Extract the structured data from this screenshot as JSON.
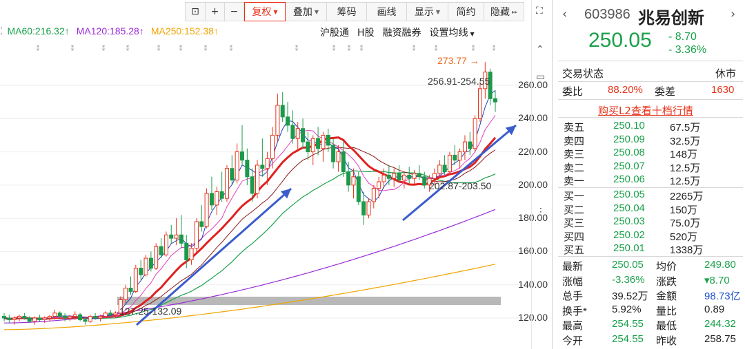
{
  "toolbar": {
    "buttons": [
      {
        "label": "",
        "icon": "lock-icon"
      },
      {
        "label": "+",
        "icon": "zoom-in-icon"
      },
      {
        "label": "−",
        "icon": "zoom-out-icon"
      },
      {
        "label": "复权",
        "dropdown": true,
        "active": true
      },
      {
        "label": "叠加",
        "dropdown": true
      },
      {
        "label": "筹码"
      },
      {
        "label": "画线"
      },
      {
        "label": "显示",
        "dropdown": true
      },
      {
        "label": "简约"
      },
      {
        "label": "隐藏",
        "more": "▸▸"
      }
    ]
  },
  "ma_legend": [
    {
      "label": "MA60:216.32",
      "arrow": "↑",
      "color": "#1aa04a"
    },
    {
      "label": "MA120:185.28",
      "arrow": "↑",
      "color": "#9a2bd8"
    },
    {
      "label": "MA250:152.38",
      "arrow": "↑",
      "color": "#f0a500"
    }
  ],
  "sub_links": [
    "沪股通",
    "H股",
    "融资融券",
    "设置均线"
  ],
  "y_axis": {
    "ticks": [
      "260.00",
      "240.00",
      "220.00",
      "200.00",
      "180.00",
      "160.00",
      "140.00",
      "120.00"
    ]
  },
  "annotations": {
    "high_marker": "273.77",
    "high_arrow": "→",
    "range_top": "256.91-254.55",
    "range_mid": "202.87-203.50",
    "range_bottom": "127.25-132.09"
  },
  "chart_data": {
    "type": "candlestick",
    "ylim": [
      110,
      280
    ],
    "y_ticks": [
      260,
      240,
      220,
      200,
      180,
      160,
      140,
      120
    ],
    "series": [
      {
        "name": "MA60",
        "color": "#1aa04a"
      },
      {
        "name": "MA120",
        "color": "#9a2bd8"
      },
      {
        "name": "MA250",
        "color": "#f0a500"
      }
    ],
    "candles": [
      [
        121,
        123,
        118,
        120
      ],
      [
        120,
        122,
        117,
        119
      ],
      [
        119,
        121,
        116,
        120
      ],
      [
        120,
        122,
        118,
        121
      ],
      [
        121,
        123,
        119,
        120
      ],
      [
        120,
        121,
        117,
        118
      ],
      [
        118,
        121,
        116,
        120
      ],
      [
        120,
        122,
        118,
        119
      ],
      [
        119,
        121,
        117,
        120
      ],
      [
        120,
        122,
        118,
        121
      ],
      [
        121,
        125,
        119,
        123
      ],
      [
        123,
        124,
        120,
        121
      ],
      [
        121,
        123,
        118,
        120
      ],
      [
        120,
        122,
        118,
        121
      ],
      [
        121,
        124,
        119,
        122
      ],
      [
        122,
        123,
        118,
        119
      ],
      [
        119,
        121,
        116,
        118
      ],
      [
        118,
        122,
        117,
        121
      ],
      [
        121,
        123,
        119,
        120
      ],
      [
        120,
        122,
        118,
        121
      ],
      [
        121,
        124,
        120,
        123
      ],
      [
        123,
        125,
        121,
        122
      ],
      [
        122,
        124,
        120,
        123
      ],
      [
        123,
        133,
        122,
        131
      ],
      [
        131,
        140,
        129,
        138
      ],
      [
        138,
        145,
        134,
        136
      ],
      [
        136,
        152,
        135,
        150
      ],
      [
        150,
        155,
        143,
        146
      ],
      [
        146,
        158,
        145,
        156
      ],
      [
        156,
        160,
        148,
        150
      ],
      [
        150,
        165,
        149,
        163
      ],
      [
        163,
        168,
        156,
        158
      ],
      [
        158,
        172,
        157,
        170
      ],
      [
        170,
        176,
        165,
        168
      ],
      [
        168,
        180,
        164,
        170
      ],
      [
        170,
        182,
        162,
        165
      ],
      [
        165,
        170,
        150,
        155
      ],
      [
        155,
        165,
        152,
        162
      ],
      [
        162,
        180,
        160,
        178
      ],
      [
        178,
        188,
        172,
        175
      ],
      [
        175,
        198,
        174,
        195
      ],
      [
        195,
        205,
        185,
        188
      ],
      [
        188,
        199,
        182,
        196
      ],
      [
        196,
        208,
        190,
        192
      ],
      [
        192,
        212,
        190,
        210
      ],
      [
        210,
        218,
        200,
        203
      ],
      [
        203,
        225,
        201,
        220
      ],
      [
        220,
        236,
        212,
        215
      ],
      [
        215,
        222,
        200,
        205
      ],
      [
        205,
        210,
        190,
        195
      ],
      [
        195,
        215,
        192,
        212
      ],
      [
        212,
        228,
        205,
        210
      ],
      [
        210,
        220,
        200,
        216
      ],
      [
        216,
        235,
        210,
        230
      ],
      [
        230,
        255,
        226,
        248
      ],
      [
        248,
        256,
        238,
        241
      ],
      [
        241,
        250,
        232,
        236
      ],
      [
        236,
        245,
        225,
        228
      ],
      [
        228,
        238,
        220,
        234
      ],
      [
        234,
        240,
        222,
        226
      ],
      [
        226,
        232,
        215,
        220
      ],
      [
        220,
        230,
        212,
        228
      ],
      [
        228,
        235,
        218,
        222
      ],
      [
        222,
        232,
        214,
        230
      ],
      [
        230,
        234,
        220,
        224
      ],
      [
        224,
        228,
        210,
        214
      ],
      [
        214,
        224,
        208,
        220
      ],
      [
        220,
        226,
        205,
        208
      ],
      [
        208,
        214,
        196,
        200
      ],
      [
        200,
        210,
        192,
        205
      ],
      [
        205,
        208,
        188,
        190
      ],
      [
        190,
        196,
        176,
        182
      ],
      [
        182,
        192,
        180,
        190
      ],
      [
        190,
        200,
        186,
        198
      ],
      [
        198,
        205,
        192,
        202
      ],
      [
        202,
        210,
        198,
        206
      ],
      [
        206,
        212,
        200,
        204
      ],
      [
        204,
        210,
        199,
        207
      ],
      [
        207,
        212,
        202,
        203
      ],
      [
        203,
        208,
        198,
        206
      ],
      [
        206,
        211,
        201,
        204
      ],
      [
        204,
        209,
        200,
        207
      ],
      [
        207,
        212,
        203,
        205
      ],
      [
        205,
        208,
        198,
        200
      ],
      [
        200,
        206,
        196,
        204
      ],
      [
        204,
        210,
        200,
        207
      ],
      [
        207,
        215,
        204,
        212
      ],
      [
        212,
        218,
        206,
        208
      ],
      [
        208,
        220,
        206,
        218
      ],
      [
        218,
        224,
        212,
        215
      ],
      [
        215,
        222,
        210,
        220
      ],
      [
        220,
        230,
        215,
        226
      ],
      [
        226,
        232,
        218,
        222
      ],
      [
        222,
        242,
        220,
        240
      ],
      [
        240,
        262,
        238,
        258
      ],
      [
        258,
        274,
        252,
        268
      ],
      [
        268,
        270,
        248,
        252
      ],
      [
        252,
        257,
        244,
        250
      ]
    ]
  },
  "panel": {
    "nav_prev": "‹",
    "nav_next": "›",
    "code": "603986",
    "name": "兆易创新",
    "price": "250.05",
    "change": "- 8.70",
    "change_pct": "- 3.36%",
    "status_label": "交易状态",
    "status_value": "休市",
    "weibi_label": "委比",
    "weibi_value": "88.20%",
    "weicha_label": "委差",
    "weicha_value": "1630",
    "buy_l2": "购买L2查看十档行情",
    "asks": [
      {
        "label": "卖五",
        "price": "250.10",
        "vol": "67.5万"
      },
      {
        "label": "卖四",
        "price": "250.09",
        "vol": "32.5万"
      },
      {
        "label": "卖三",
        "price": "250.08",
        "vol": "148万"
      },
      {
        "label": "卖二",
        "price": "250.07",
        "vol": "12.5万"
      },
      {
        "label": "卖一",
        "price": "250.06",
        "vol": "12.5万"
      }
    ],
    "bids": [
      {
        "label": "买一",
        "price": "250.05",
        "vol": "2265万"
      },
      {
        "label": "买二",
        "price": "250.04",
        "vol": "150万"
      },
      {
        "label": "买三",
        "price": "250.03",
        "vol": "75.0万"
      },
      {
        "label": "买四",
        "price": "250.02",
        "vol": "520万"
      },
      {
        "label": "买五",
        "price": "250.01",
        "vol": "1338万"
      }
    ],
    "stats": [
      {
        "l1": "最新",
        "v1": "250.05",
        "c1": "green",
        "l2": "均价",
        "v2": "249.80",
        "c2": "green"
      },
      {
        "l1": "涨幅",
        "v1": "-3.36%",
        "c1": "green",
        "l2": "涨跌",
        "v2": "▾8.70",
        "c2": "green"
      },
      {
        "l1": "总手",
        "v1": "39.52万",
        "c1": "dark",
        "l2": "金额",
        "v2": "98.73亿",
        "c2": "blue"
      },
      {
        "l1": "换手*",
        "v1": "5.92%",
        "c1": "dark",
        "l2": "量比",
        "v2": "0.89",
        "c2": "dark"
      },
      {
        "l1": "最高",
        "v1": "254.55",
        "c1": "green",
        "l2": "最低",
        "v2": "244.32",
        "c2": "green"
      },
      {
        "l1": "今开",
        "v1": "254.55",
        "c1": "green",
        "l2": "昨收",
        "v2": "258.75",
        "c2": "dark"
      }
    ]
  }
}
